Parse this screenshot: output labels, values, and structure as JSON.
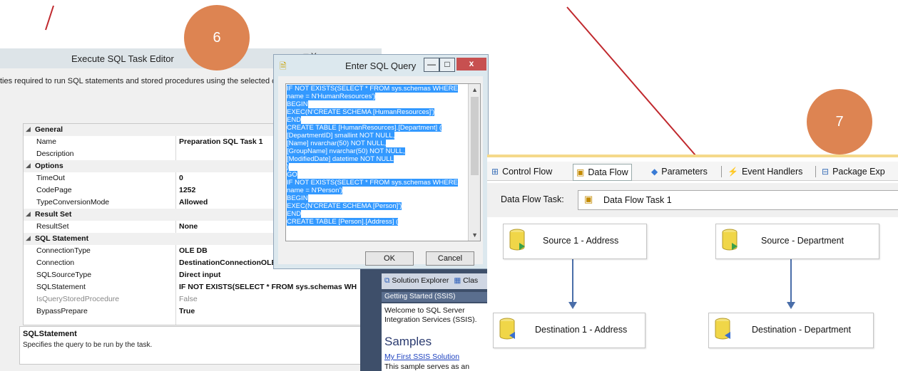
{
  "editor": {
    "title": "Execute SQL Task Editor",
    "description": "ties required to run SQL statements and stored procedures using the selected co",
    "window_buttons": "— □ X",
    "categories": [
      {
        "label": "General",
        "rows": [
          {
            "name": "Name",
            "value": "Preparation SQL Task 1",
            "grayed": false
          },
          {
            "name": "Description",
            "value": "",
            "grayed": false
          }
        ]
      },
      {
        "label": "Options",
        "rows": [
          {
            "name": "TimeOut",
            "value": "0",
            "grayed": false
          },
          {
            "name": "CodePage",
            "value": "1252",
            "grayed": false
          },
          {
            "name": "TypeConversionMode",
            "value": "Allowed",
            "grayed": false
          }
        ]
      },
      {
        "label": "Result Set",
        "rows": [
          {
            "name": "ResultSet",
            "value": "None",
            "grayed": false
          }
        ]
      },
      {
        "label": "SQL Statement",
        "rows": [
          {
            "name": "ConnectionType",
            "value": "OLE DB",
            "grayed": false
          },
          {
            "name": "Connection",
            "value": "DestinationConnectionOLE",
            "grayed": false
          },
          {
            "name": "SQLSourceType",
            "value": "Direct input",
            "grayed": false
          },
          {
            "name": "SQLStatement",
            "value": "IF NOT EXISTS(SELECT * FROM sys.schemas WH",
            "grayed": false
          },
          {
            "name": "IsQueryStoredProcedure",
            "value": "False",
            "grayed": true
          },
          {
            "name": "BypassPrepare",
            "value": "True",
            "grayed": false
          }
        ]
      }
    ],
    "help": {
      "title": "SQLStatement",
      "text": "Specifies the query to be run by the task."
    }
  },
  "sql_dialog": {
    "title": "Enter SQL Query",
    "lines": [
      "IF NOT EXISTS(SELECT * FROM sys.schemas WHERE",
      "name = N'HumanResources')",
      "BEGIN",
      "EXEC(N'CREATE SCHEMA [HumanResources]')",
      "END",
      "CREATE TABLE [HumanResources].[Department] (",
      "[DepartmentID] smallint NOT NULL,",
      "[Name] nvarchar(50) NOT NULL,",
      "[GroupName] nvarchar(50) NOT NULL,",
      "[ModifiedDate] datetime NOT NULL",
      ")",
      "GO",
      "IF NOT EXISTS(SELECT * FROM sys.schemas WHERE",
      "name = N'Person')",
      "BEGIN",
      "EXEC(N'CREATE SCHEMA [Person]')",
      "END",
      "CREATE TABLE [Person].[Address] ("
    ],
    "ok_label": "OK",
    "cancel_label": "Cancel"
  },
  "solution_explorer": {
    "tab_label": "Solution Explorer",
    "tab2_label": "Clas",
    "getting_started": "Getting Started (SSIS)",
    "welcome": "Welcome to SQL Server Integration Services (SSIS).",
    "samples_heading": "Samples",
    "link": "My First SSIS Solution",
    "sample_text": "This sample serves as an"
  },
  "callouts": [
    "6",
    "7"
  ],
  "designer": {
    "tabs": [
      {
        "label": "Control Flow",
        "icon": "control-flow-icon"
      },
      {
        "label": "Data Flow",
        "icon": "data-flow-icon"
      },
      {
        "label": "Parameters",
        "icon": "parameters-icon"
      },
      {
        "label": "Event Handlers",
        "icon": "event-handlers-icon"
      },
      {
        "label": "Package Exp",
        "icon": "package-explorer-icon"
      }
    ],
    "data_flow_task_label": "Data Flow Task:",
    "data_flow_task_value": "Data Flow Task 1",
    "components": {
      "source1": "Source 1 - Address",
      "source2": "Source - Department",
      "dest1": "Destination 1 - Address",
      "dest2": "Destination - Department"
    }
  },
  "colors": {
    "callout": "#dd8452",
    "annotation_line": "#c0282d",
    "selection": "#3399ff",
    "connector": "#4a6ea9"
  }
}
